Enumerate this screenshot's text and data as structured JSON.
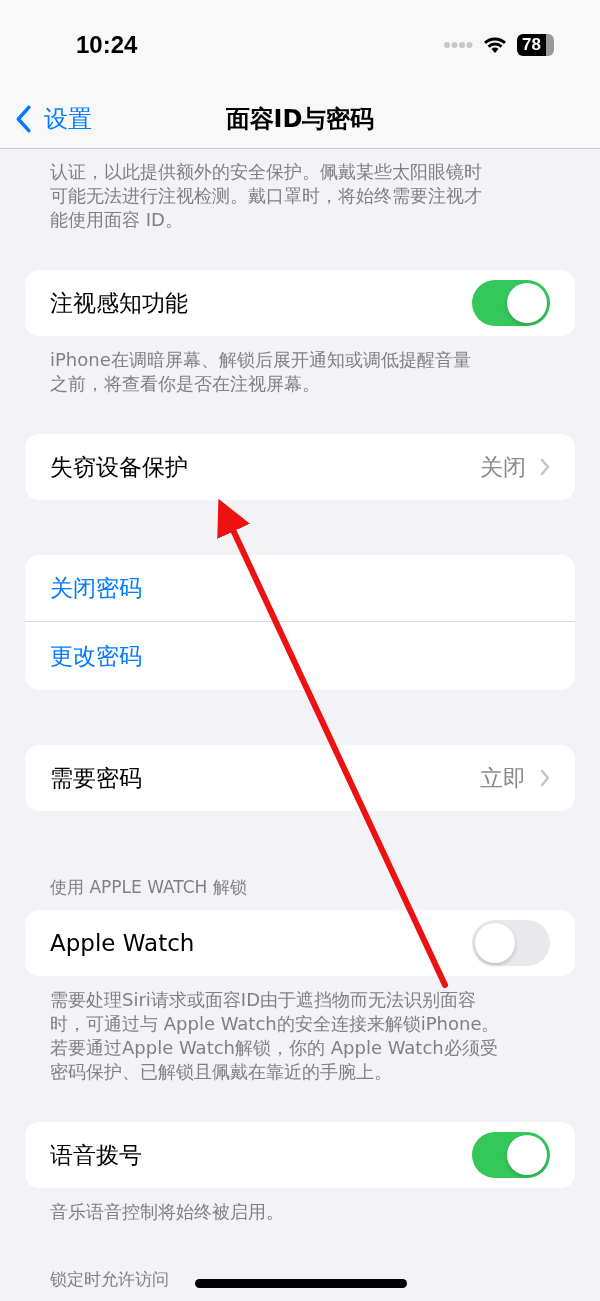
{
  "status_bar": {
    "time": "10:24",
    "battery": "78"
  },
  "nav": {
    "back": "设置",
    "title": "面容ID与密码"
  },
  "sections": [
    {
      "kind": "footer",
      "lines": [
        "认证，以此提供额外的安全保护。佩戴某些太阳眼镜时",
        "可能无法进行注视检测。戴口罩时，将始终需要注视才",
        "能使用面容 ID。"
      ]
    },
    {
      "kind": "card",
      "rows": [
        {
          "kind": "toggle",
          "label": "注视感知功能",
          "on": true
        }
      ]
    },
    {
      "kind": "footer",
      "lines": [
        "iPhone在调暗屏幕、解锁后展开通知或调低提醒音量",
        "之前，将查看你是否在注视屏幕。"
      ]
    },
    {
      "kind": "card",
      "rows": [
        {
          "kind": "value",
          "label": "失窃设备保护",
          "value": "关闭"
        }
      ]
    },
    {
      "kind": "card",
      "rows": [
        {
          "kind": "action",
          "label": "关闭密码"
        },
        {
          "kind": "action",
          "label": "更改密码"
        }
      ]
    },
    {
      "kind": "card",
      "rows": [
        {
          "kind": "value",
          "label": "需要密码",
          "value": "立即"
        }
      ]
    },
    {
      "kind": "header",
      "text": "使用 APPLE WATCH 解锁"
    },
    {
      "kind": "card",
      "rows": [
        {
          "kind": "toggle",
          "label": "Apple Watch",
          "on": false
        }
      ]
    },
    {
      "kind": "footer",
      "lines": [
        "需要处理Siri请求或面容ID由于遮挡物而无法识别面容",
        "时，可通过与 Apple Watch的安全连接来解锁iPhone。",
        "若要通过Apple Watch解锁，你的 Apple Watch必须受",
        "密码保护、已解锁且佩戴在靠近的手腕上。"
      ]
    },
    {
      "kind": "card",
      "rows": [
        {
          "kind": "toggle",
          "label": "语音拨号",
          "on": true
        }
      ]
    },
    {
      "kind": "footer",
      "lines": [
        "音乐语音控制将始终被启用。"
      ]
    },
    {
      "kind": "header",
      "text": "锁定时允许访问"
    }
  ]
}
